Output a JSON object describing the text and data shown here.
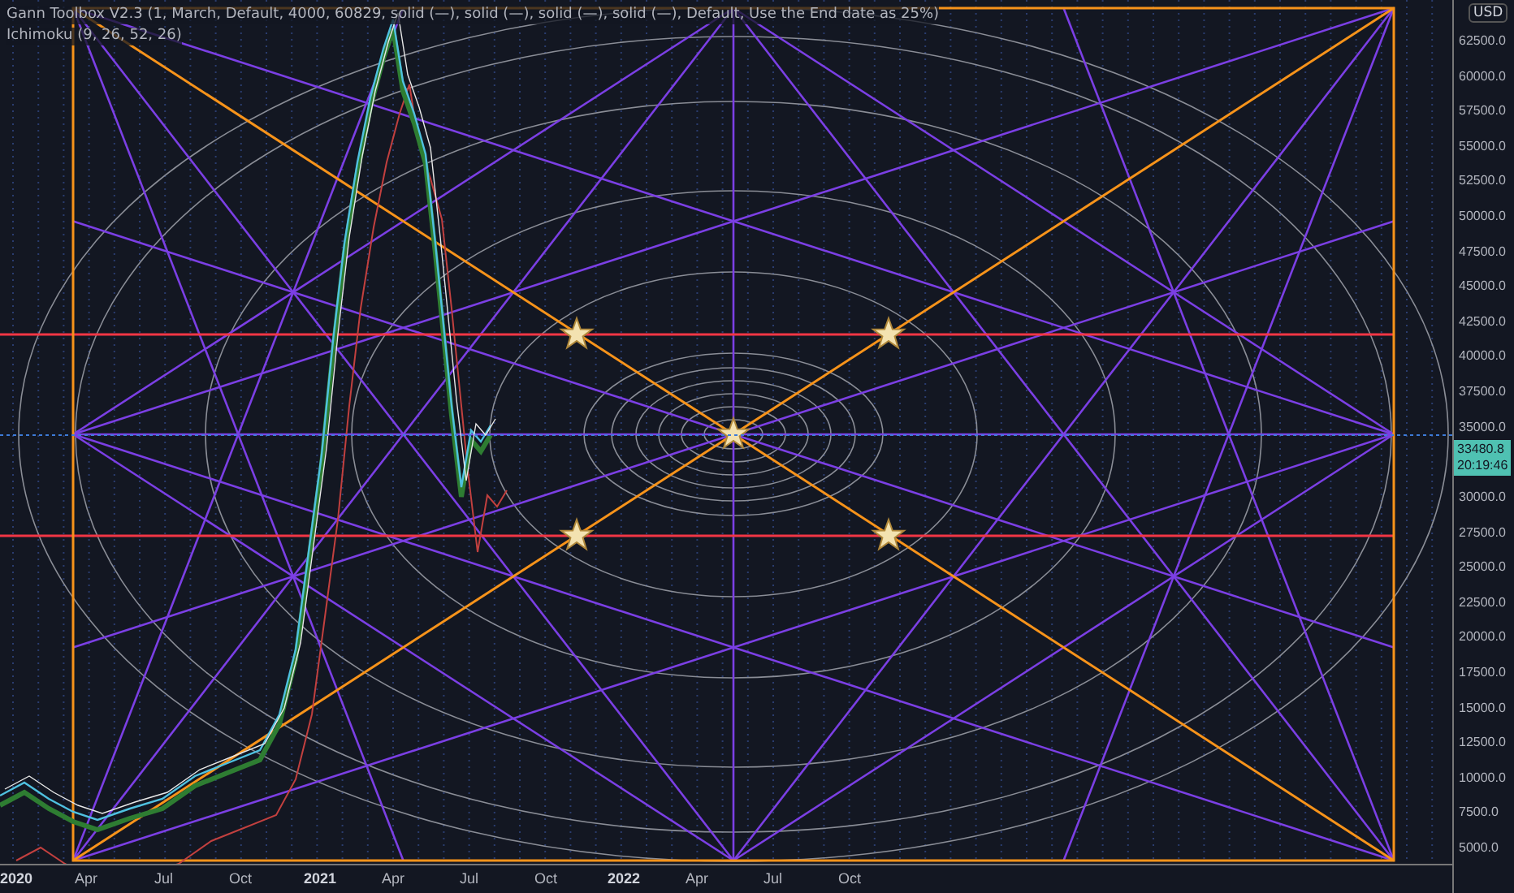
{
  "legend": [
    {
      "text": "Gann Toolbox V2.3 (1, March, Default, 4000, 60829, solid (—), solid (—), solid (—), solid (—), Default, Use the End date as 25%)"
    },
    {
      "text": "Ichimoku (9, 26, 52, 26)"
    }
  ],
  "price_axis": {
    "currency": "USD",
    "ticks": [
      "62500.0",
      "60000.0",
      "57500.0",
      "55000.0",
      "52500.0",
      "50000.0",
      "47500.0",
      "45000.0",
      "42500.0",
      "40000.0",
      "37500.0",
      "35000.0",
      "30000.0",
      "27500.0",
      "25000.0",
      "22500.0",
      "20000.0",
      "17500.0",
      "15000.0",
      "12500.0",
      "10000.0",
      "7500.0",
      "5000.0"
    ],
    "last_price": "33480.8",
    "countdown": "20:19:46"
  },
  "time_axis": {
    "labels": [
      {
        "text": "2020",
        "kind": "year"
      },
      {
        "text": "Apr",
        "kind": "month"
      },
      {
        "text": "Jul",
        "kind": "month"
      },
      {
        "text": "Oct",
        "kind": "month"
      },
      {
        "text": "2021",
        "kind": "year"
      },
      {
        "text": "Apr",
        "kind": "month"
      },
      {
        "text": "Jul",
        "kind": "month"
      },
      {
        "text": "Oct",
        "kind": "month"
      },
      {
        "text": "2022",
        "kind": "year"
      },
      {
        "text": "Apr",
        "kind": "month"
      },
      {
        "text": "Jul",
        "kind": "month"
      },
      {
        "text": "Oct",
        "kind": "month"
      }
    ]
  }
}
